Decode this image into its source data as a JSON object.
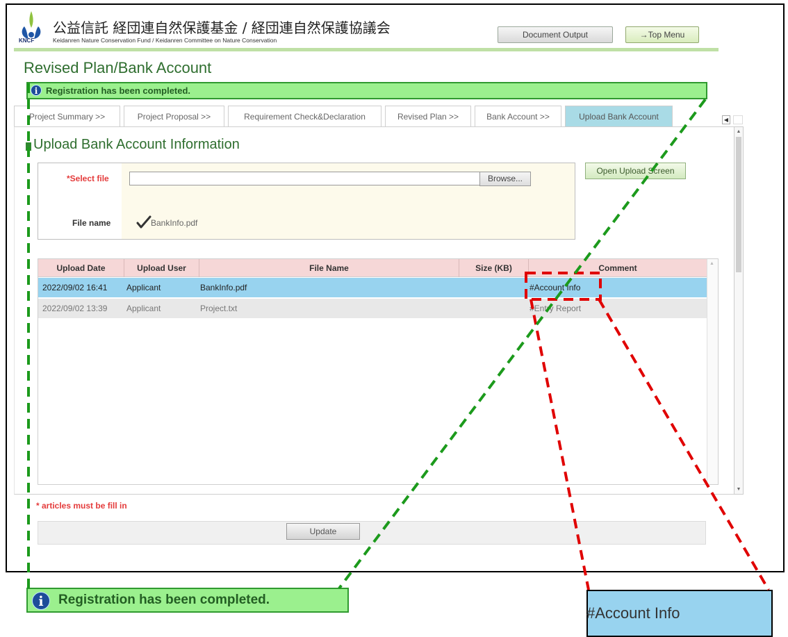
{
  "header": {
    "logo_text": "KNCF",
    "org_title": "公益信託 経団連自然保護基金 / 経団連自然保護協議会",
    "org_subtitle": "Keidanren Nature Conservation Fund / Keidanren Committee on Nature Conservation",
    "document_output_label": "Document Output",
    "top_menu_label": "→Top Menu"
  },
  "page": {
    "title": "Revised Plan/Bank Account",
    "notice": "Registration has been completed."
  },
  "tabs": [
    {
      "label": "Project Summary >>"
    },
    {
      "label": "Project Proposal >>"
    },
    {
      "label": "Requirement Check&Declaration"
    },
    {
      "label": "Revised Plan >>"
    },
    {
      "label": "Bank Account >>"
    },
    {
      "label": "Upload Bank Account",
      "active": true
    }
  ],
  "section": {
    "title": "Upload Bank Account Information",
    "select_file_label": "*Select file",
    "browse_label": "Browse...",
    "file_name_label": "File name",
    "file_name_value": "BankInfo.pdf",
    "open_upload_label": "Open Upload Screen"
  },
  "table": {
    "headers": [
      "Upload Date",
      "Upload User",
      "File Name",
      "Size (KB)",
      "Comment"
    ],
    "rows": [
      {
        "date": "2022/09/02 16:41",
        "user": "Applicant",
        "file": "BankInfo.pdf",
        "size": "",
        "comment": "#Account Info",
        "selected": true
      },
      {
        "date": "2022/09/02 13:39",
        "user": "Applicant",
        "file": "Project.txt",
        "size": "",
        "comment": "#Entry Report",
        "selected": false
      }
    ]
  },
  "footer": {
    "required_note": "* articles must be fill in",
    "update_label": "Update"
  },
  "callouts": {
    "zoom_notice": "Registration has been completed.",
    "zoom_comment": "#Account Info"
  },
  "colors": {
    "accent_green": "#2f6e2f",
    "notice_bg": "#9bf08e",
    "selected_row": "#98d3ef",
    "required_red": "#e43b3b",
    "callout_green_dash": "#1c9a1c",
    "callout_red_dash": "#e00000"
  }
}
